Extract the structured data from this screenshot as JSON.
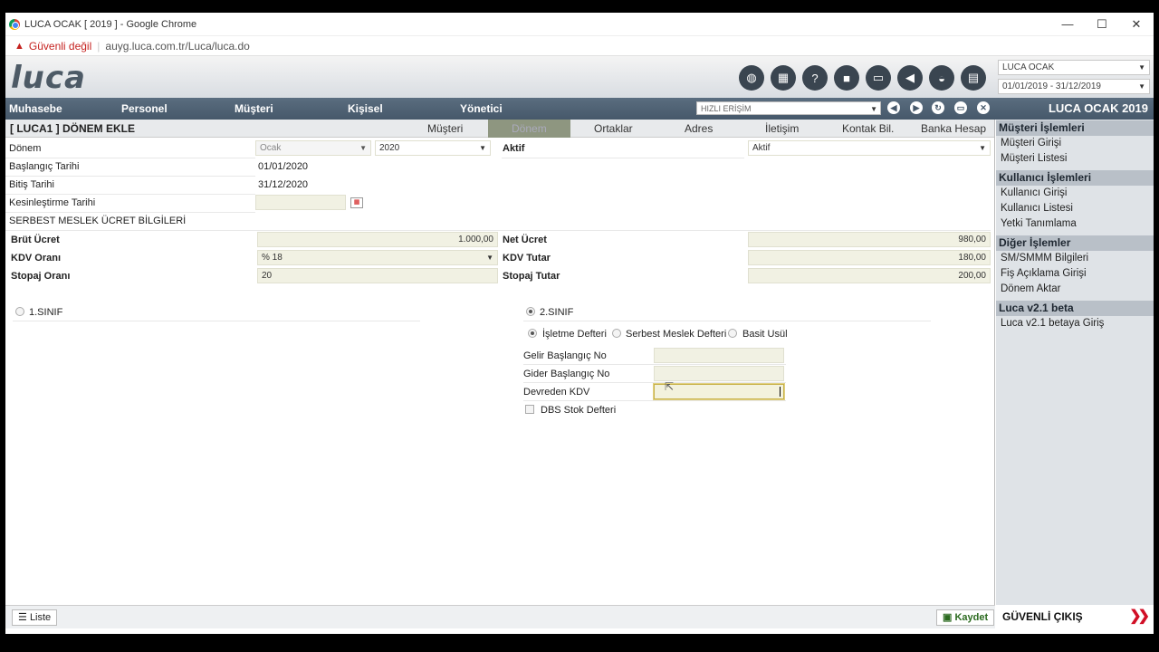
{
  "window": {
    "title": "LUCA OCAK [ 2019 ] - Google Chrome",
    "minimize": "—",
    "maximize": "☐",
    "close": "✕"
  },
  "address": {
    "security": "Güvenli değil",
    "url": "auyg.luca.com.tr/Luca/luca.do"
  },
  "header": {
    "logo": "luca",
    "company_select": "LUCA OCAK",
    "period_select": "01/01/2019 - 31/12/2019",
    "toolbar_icons": [
      "globe-icon",
      "calculator-icon",
      "help-icon",
      "video-icon",
      "monitor-icon",
      "megaphone-icon",
      "bell-icon",
      "book-icon"
    ]
  },
  "menu": {
    "items": [
      "Muhasebe",
      "Personel",
      "Müşteri",
      "Kişisel",
      "Yönetici"
    ],
    "quick_access": "HIZLI ERİŞİM",
    "app_title": "LUCA OCAK 2019"
  },
  "form": {
    "title": "[ LUCA1 ] DÖNEM EKLE",
    "tabs": [
      "Müşteri",
      "Dönem",
      "Ortaklar",
      "Adres",
      "İletişim",
      "Kontak Bil.",
      "Banka Hesap"
    ],
    "active_tab": "Dönem",
    "donem_label": "Dönem",
    "donem_month": "Ocak",
    "donem_year": "2020",
    "aktif_label": "Aktif",
    "aktif_value": "Aktif",
    "baslangic_label": "Başlangıç Tarihi",
    "baslangic_value": "01/01/2020",
    "bitis_label": "Bitiş Tarihi",
    "bitis_value": "31/12/2020",
    "kesinlestirme_label": "Kesinleştirme Tarihi",
    "kesinlestirme_value": "",
    "smm_section": "SERBEST MESLEK ÜCRET BİLGİLERİ",
    "brut_label": "Brüt Ücret",
    "brut_value": "1.000,00",
    "net_label": "Net Ücret",
    "net_value": "980,00",
    "kdv_oran_label": "KDV Oranı",
    "kdv_oran_value": "% 18",
    "kdv_tutar_label": "KDV Tutar",
    "kdv_tutar_value": "180,00",
    "stopaj_oran_label": "Stopaj Oranı",
    "stopaj_oran_value": "20",
    "stopaj_tutar_label": "Stopaj Tutar",
    "stopaj_tutar_value": "200,00",
    "sinif1_label": "1.SINIF",
    "sinif2_label": "2.SINIF",
    "isletme_label": "İşletme Defteri",
    "serbest_label": "Serbest Meslek Defteri",
    "basit_label": "Basit Usül",
    "gelir_label": "Gelir Başlangıç No",
    "gelir_value": "",
    "gider_label": "Gider Başlangıç No",
    "gider_value": "",
    "devreden_label": "Devreden KDV",
    "devreden_value": "",
    "dbs_label": "DBS Stok Defteri"
  },
  "footer": {
    "list_button": "Liste",
    "save_button": "Kaydet"
  },
  "sidebar": {
    "sections": [
      {
        "title": "Müşteri İşlemleri",
        "items": [
          "Müşteri Girişi",
          "Müşteri Listesi"
        ]
      },
      {
        "title": "Kullanıcı İşlemleri",
        "items": [
          "Kullanıcı Girişi",
          "Kullanıcı Listesi",
          "Yetki Tanımlama"
        ]
      },
      {
        "title": "Diğer İşlemler",
        "items": [
          "SM/SMMM Bilgileri",
          "Fiş Açıklama Girişi",
          "Dönem Aktar"
        ]
      },
      {
        "title": "Luca v2.1 beta",
        "items": [
          "Luca v2.1 betaya Giriş"
        ]
      }
    ],
    "logout": "GÜVENLİ ÇIKIŞ"
  },
  "colors": {
    "menubar": "#4f6173",
    "active_tab": "#8e9680",
    "field_bg": "#f1f1e3",
    "logout_arrow": "#d10f26"
  }
}
